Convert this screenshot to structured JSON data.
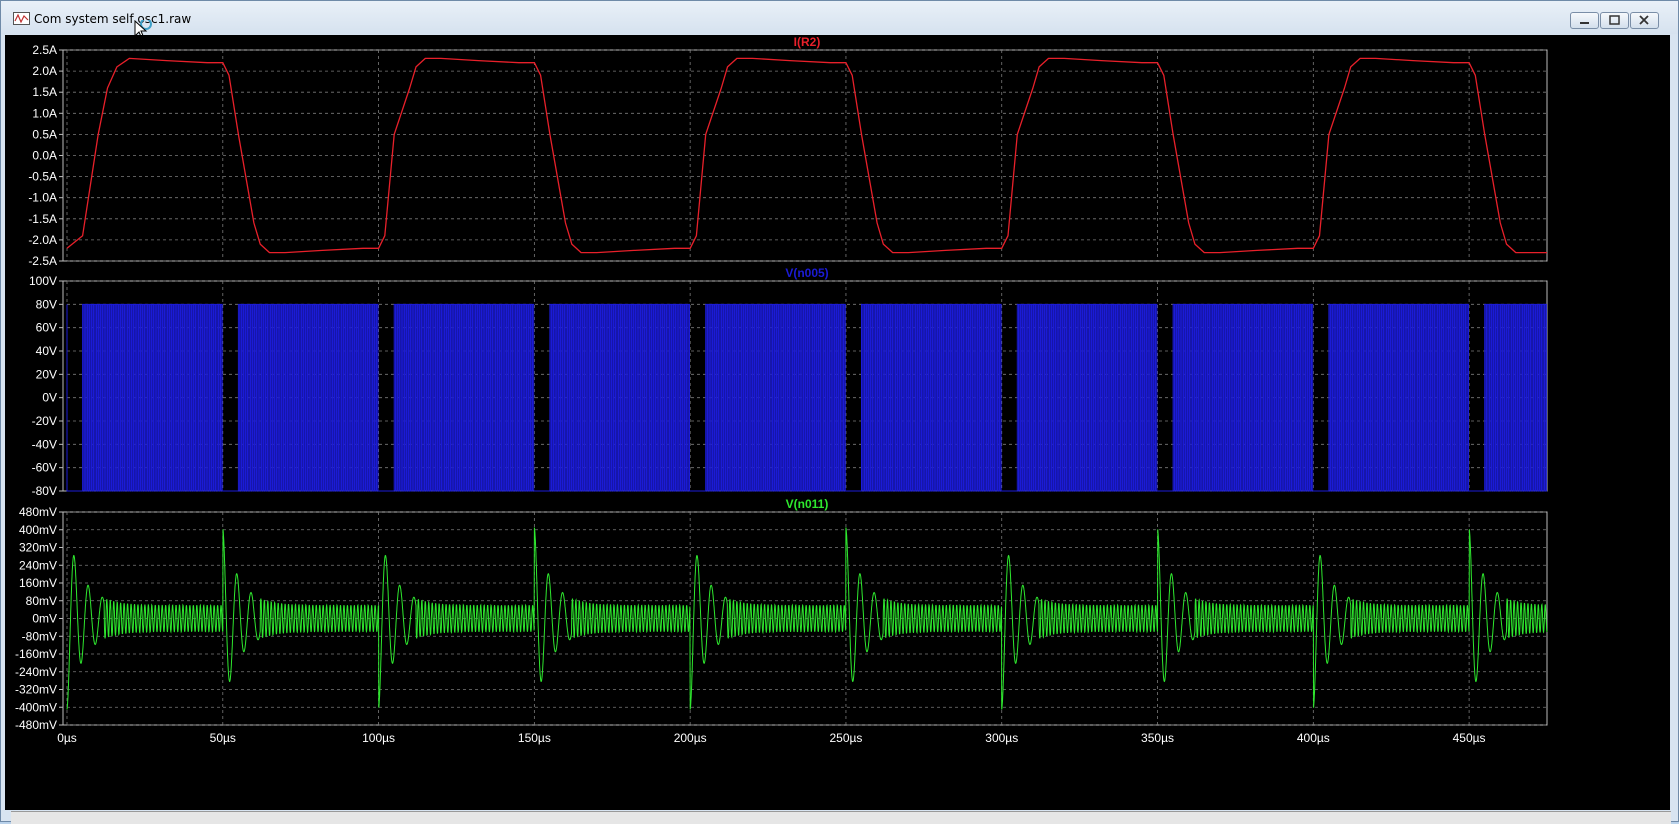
{
  "window": {
    "title": "Com system self osc1.raw"
  },
  "panes": [
    {
      "trace": "I(R2)",
      "color": "#e8202a",
      "y_ticks": [
        "2.5A",
        "2.0A",
        "1.5A",
        "1.0A",
        "0.5A",
        "0.0A",
        "-0.5A",
        "-1.0A",
        "-1.5A",
        "-2.0A",
        "-2.5A"
      ]
    },
    {
      "trace": "V(n005)",
      "color": "#1b1bd6",
      "y_ticks": [
        "100V",
        "80V",
        "60V",
        "40V",
        "20V",
        "0V",
        "-20V",
        "-40V",
        "-60V",
        "-80V"
      ]
    },
    {
      "trace": "V(n011)",
      "color": "#2ee82e",
      "y_ticks": [
        "480mV",
        "400mV",
        "320mV",
        "240mV",
        "160mV",
        "80mV",
        "0mV",
        "-80mV",
        "-160mV",
        "-240mV",
        "-320mV",
        "-400mV",
        "-480mV"
      ]
    }
  ],
  "x_ticks": [
    "0µs",
    "50µs",
    "100µs",
    "150µs",
    "200µs",
    "250µs",
    "300µs",
    "350µs",
    "400µs",
    "450µs"
  ],
  "chart_data": [
    {
      "type": "line",
      "title": "I(R2)",
      "xlim": [
        0,
        475
      ],
      "ylim": [
        -2.5,
        2.5
      ],
      "series": [
        {
          "name": "I(R2)",
          "x": [
            0,
            5,
            10,
            13,
            16,
            20,
            32,
            45,
            50,
            52,
            55,
            60,
            62,
            65,
            70,
            82,
            95,
            100,
            102,
            105,
            110,
            112,
            115,
            120,
            132,
            145,
            150,
            152,
            155,
            160,
            162,
            165,
            170,
            182,
            195,
            200,
            202,
            205,
            210,
            212,
            215,
            220,
            232,
            245,
            250,
            252,
            255,
            260,
            262,
            265,
            270,
            282,
            295,
            300,
            302,
            305,
            310,
            312,
            315,
            320,
            332,
            345,
            350,
            352,
            355,
            360,
            362,
            365,
            370,
            382,
            395,
            400,
            402,
            405,
            410,
            412,
            415,
            420,
            432,
            445,
            450,
            452,
            455,
            460,
            462,
            465,
            470,
            475
          ],
          "y": [
            -2.2,
            -1.9,
            0.5,
            1.6,
            2.1,
            2.3,
            2.25,
            2.2,
            2.2,
            1.9,
            0.5,
            -1.6,
            -2.1,
            -2.3,
            -2.3,
            -2.25,
            -2.2,
            -2.2,
            -1.9,
            0.5,
            1.6,
            2.1,
            2.3,
            2.3,
            2.25,
            2.2,
            2.2,
            1.9,
            0.5,
            -1.6,
            -2.1,
            -2.3,
            -2.3,
            -2.25,
            -2.2,
            -2.2,
            -1.9,
            0.5,
            1.6,
            2.1,
            2.3,
            2.3,
            2.25,
            2.2,
            2.2,
            1.9,
            0.5,
            -1.6,
            -2.1,
            -2.3,
            -2.3,
            -2.25,
            -2.2,
            -2.2,
            -1.9,
            0.5,
            1.6,
            2.1,
            2.3,
            2.3,
            2.25,
            2.2,
            2.2,
            1.9,
            0.5,
            -1.6,
            -2.1,
            -2.3,
            -2.3,
            -2.25,
            -2.2,
            -2.2,
            -1.9,
            0.5,
            1.6,
            2.1,
            2.3,
            2.3,
            2.25,
            2.2,
            2.2,
            1.9,
            0.5,
            -1.6,
            -2.1,
            -2.3,
            -2.3,
            -2.3
          ]
        }
      ],
      "grid": true
    },
    {
      "type": "line",
      "title": "V(n005)",
      "xlim": [
        0,
        475
      ],
      "ylim": [
        -80,
        100
      ],
      "description_values": {
        "high": 80,
        "low": -80,
        "switching_segments_us": [
          [
            5,
            50
          ],
          [
            55,
            100
          ],
          [
            105,
            150
          ],
          [
            155,
            200
          ],
          [
            205,
            250
          ],
          [
            255,
            300
          ],
          [
            305,
            350
          ],
          [
            355,
            400
          ],
          [
            405,
            450
          ],
          [
            455,
            475
          ]
        ]
      },
      "series": [
        {
          "name": "V(n005)"
        }
      ],
      "grid": true
    },
    {
      "type": "line",
      "title": "V(n011)",
      "xlim": [
        0,
        475
      ],
      "ylim": [
        -480,
        480
      ],
      "description_values": {
        "burst_starts_us": [
          0,
          50,
          100,
          150,
          200,
          250,
          300,
          350,
          400,
          450
        ],
        "peak_mV": 410,
        "trough_mV": -400,
        "steady_ripple_mV": 60
      },
      "series": [
        {
          "name": "V(n011)"
        }
      ],
      "grid": true
    }
  ]
}
